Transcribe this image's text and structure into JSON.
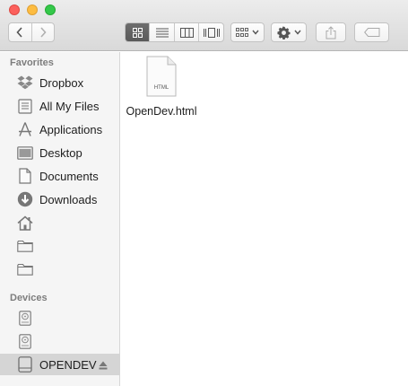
{
  "window": {
    "controls": [
      "close",
      "minimize",
      "maximize"
    ]
  },
  "toolbar": {
    "back_icon": "chevron-left-icon",
    "forward_icon": "chevron-right-icon",
    "view_modes": [
      "icon-view-icon",
      "list-view-icon",
      "column-view-icon",
      "cover-flow-icon"
    ],
    "active_view": "icon-view-icon",
    "arrange_icon": "arrange-grid-icon",
    "action_icon": "gear-icon",
    "share_icon": "share-icon",
    "tag_icon": "tag-icon"
  },
  "sidebar": {
    "favorites_label": "Favorites",
    "favorites": [
      {
        "label": "Dropbox",
        "icon": "dropbox-icon"
      },
      {
        "label": "All My Files",
        "icon": "all-files-icon"
      },
      {
        "label": "Applications",
        "icon": "applications-icon"
      },
      {
        "label": "Desktop",
        "icon": "desktop-icon"
      },
      {
        "label": "Documents",
        "icon": "documents-icon"
      },
      {
        "label": "Downloads",
        "icon": "downloads-icon"
      },
      {
        "label": "",
        "icon": "home-icon"
      },
      {
        "label": "",
        "icon": "folder-icon"
      },
      {
        "label": "",
        "icon": "folder-icon"
      }
    ],
    "devices_label": "Devices",
    "devices": [
      {
        "label": "",
        "icon": "hard-disk-icon"
      },
      {
        "label": "",
        "icon": "hard-disk-icon"
      },
      {
        "label": "OPENDEV",
        "icon": "external-disk-icon",
        "selected": true
      }
    ]
  },
  "main": {
    "files": [
      {
        "name": "OpenDev.html",
        "type_label": "HTML",
        "icon": "html-file-icon"
      }
    ]
  },
  "colors": {
    "selected_row": "#d5d5d5",
    "sidebar_bg": "#f5f5f5",
    "close": "#fc605c",
    "minimize": "#fdbc40",
    "maximize": "#34c84a"
  }
}
